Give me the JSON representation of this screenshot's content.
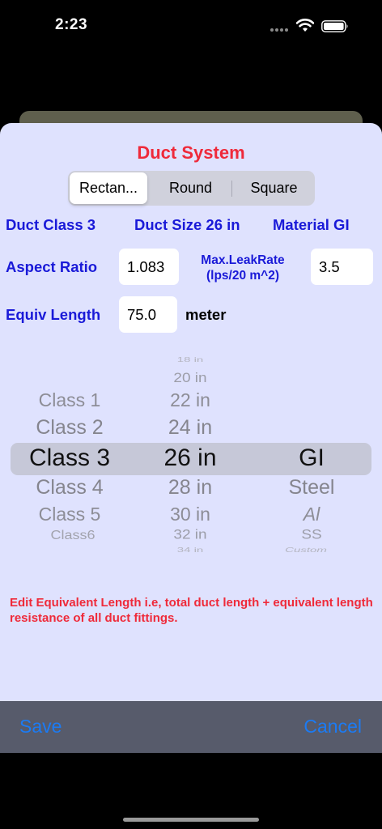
{
  "status_bar": {
    "time": "2:23"
  },
  "sheet": {
    "title": "Duct System",
    "segments": [
      "Rectan...",
      "Round",
      "Square"
    ],
    "selected_segment": "Rectan...",
    "info": {
      "duct_class": "Duct Class 3",
      "duct_size": "Duct Size 26 in",
      "material": "Material GI"
    },
    "aspect_ratio": {
      "label": "Aspect Ratio",
      "value": "1.083"
    },
    "max_leak_rate": {
      "label_line1": "Max.LeakRate",
      "label_line2": "(lps/20 m^2)",
      "value": "3.5"
    },
    "equiv_length": {
      "label": "Equiv Length",
      "value": "75.0",
      "unit": "meter"
    },
    "picker": {
      "class_items": [
        "Class 1",
        "Class 2",
        "Class 3",
        "Class 4",
        "Class 5",
        "Class6"
      ],
      "size_items": [
        "18 in",
        "20 in",
        "22 in",
        "24 in",
        "26 in",
        "28 in",
        "30 in",
        "32 in",
        "34 in"
      ],
      "material_items": [
        "GI",
        "Steel",
        "Al",
        "SS",
        "Custom"
      ],
      "selected": {
        "class": "Class 3",
        "size": "26 in",
        "material": "GI"
      }
    },
    "hint": "Edit Equivalent Length i.e, total duct length + equivalent length resistance of all duct fittings."
  },
  "toolbar": {
    "save_label": "Save",
    "cancel_label": "Cancel"
  },
  "colors": {
    "title_red": "#ef2a3a",
    "label_blue": "#1a1ad8",
    "sheet_bg": "#dfe2fe",
    "toolbar_bg": "#575b6b",
    "button_blue": "#1b7bf4"
  }
}
